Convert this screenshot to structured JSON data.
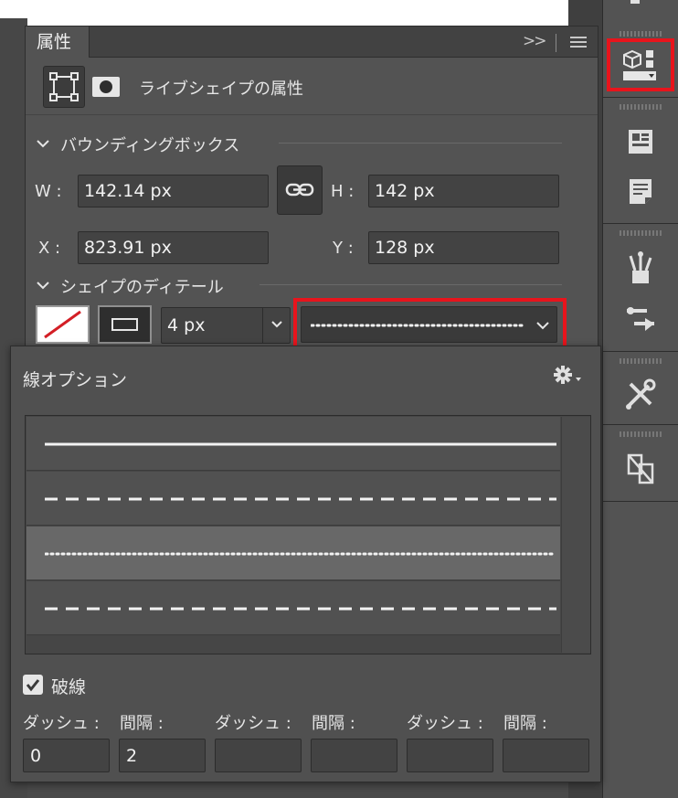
{
  "properties_panel": {
    "tab_title": "属性",
    "collapse_glyph": ">>",
    "shape_title": "ライブシェイプの属性",
    "bounding_box": {
      "section_title": "バウンディングボックス",
      "w_label": "W :",
      "w_value": "142.14 px",
      "h_label": "H :",
      "h_value": "142 px",
      "x_label": "X :",
      "x_value": "823.91 px",
      "y_label": "Y :",
      "y_value": "128 px"
    },
    "shape_details": {
      "section_title": "シェイプのディテール",
      "stroke_width": "4 px"
    }
  },
  "stroke_options_popup": {
    "title": "線オプション",
    "dashed_label": "破線",
    "dashed_checked": true,
    "dash_fields": [
      {
        "label": "ダッシュ :",
        "value": "0"
      },
      {
        "label": "間隔 :",
        "value": "2"
      },
      {
        "label": "ダッシュ :",
        "value": ""
      },
      {
        "label": "間隔 :",
        "value": ""
      },
      {
        "label": "ダッシュ :",
        "value": ""
      },
      {
        "label": "間隔 :",
        "value": ""
      }
    ],
    "selected_style_index": 2
  },
  "colors": {
    "panel_bg": "#535353",
    "field_bg": "#434343",
    "highlight_red": "#e8141c",
    "selected_row": "#686868"
  }
}
